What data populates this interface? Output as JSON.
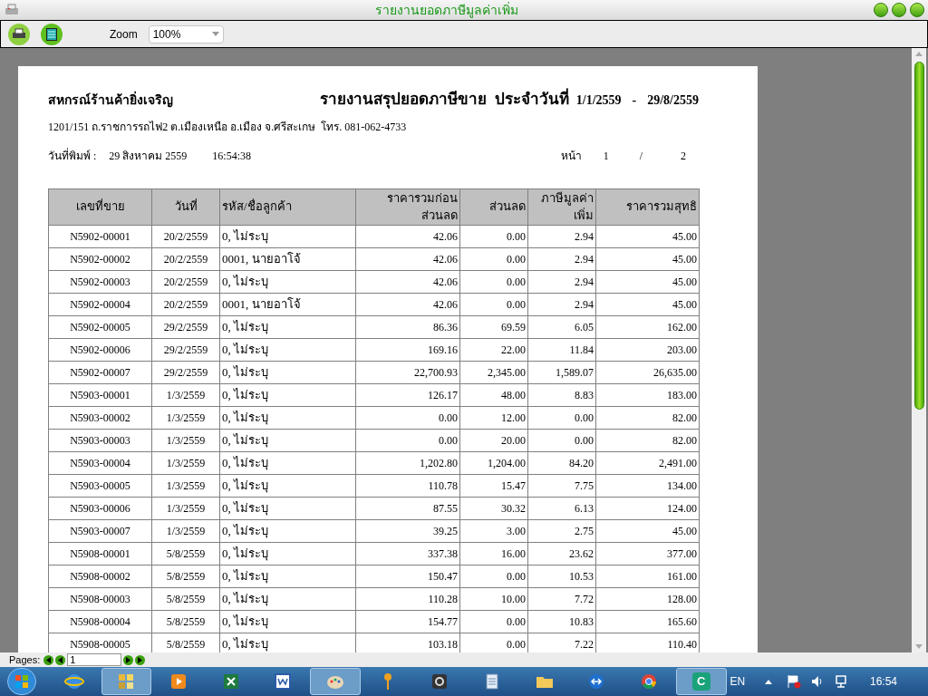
{
  "window": {
    "title": "รายงานยอดภาษีมูลค่าเพิ่ม"
  },
  "toolbar": {
    "zoom_label": "Zoom",
    "zoom_value": "100%"
  },
  "report": {
    "company": "สหกรณ์ร้านค้ายิ่งเจริญ",
    "title": "รายงานสรุปยอดภาษีขาย  ประจำวันที่",
    "date_from": "1/1/2559",
    "date_sep": "-",
    "date_to": "29/8/2559",
    "address": "1201/151 ถ.ราชการรถไฟ2 ต.เมืองเหนือ อ.เมือง จ.ศรีสะเกษ  โทร. 081-062-4733",
    "print_label": "วันที่พิมพ์ :",
    "print_date": "29 สิงหาคม 2559",
    "print_time": "16:54:38",
    "page_label": "หน้า",
    "page_no": "1",
    "page_sep": "/",
    "page_total": "2"
  },
  "table": {
    "columns": [
      "เลขที่ขาย",
      "วันที่",
      "รหัส/ชื่อลูกค้า",
      "ราคารวมก่อนส่วนลด",
      "ส่วนลด",
      "ภาษีมูลค่าเพิ่ม",
      "ราคารวมสุทธิ"
    ],
    "rows": [
      [
        "N5902-00001",
        "20/2/2559",
        "0, ไม่ระบุ",
        "42.06",
        "0.00",
        "2.94",
        "45.00"
      ],
      [
        "N5902-00002",
        "20/2/2559",
        "0001, นายอาโจ้",
        "42.06",
        "0.00",
        "2.94",
        "45.00"
      ],
      [
        "N5902-00003",
        "20/2/2559",
        "0, ไม่ระบุ",
        "42.06",
        "0.00",
        "2.94",
        "45.00"
      ],
      [
        "N5902-00004",
        "20/2/2559",
        "0001, นายอาโจ้",
        "42.06",
        "0.00",
        "2.94",
        "45.00"
      ],
      [
        "N5902-00005",
        "29/2/2559",
        "0, ไม่ระบุ",
        "86.36",
        "69.59",
        "6.05",
        "162.00"
      ],
      [
        "N5902-00006",
        "29/2/2559",
        "0, ไม่ระบุ",
        "169.16",
        "22.00",
        "11.84",
        "203.00"
      ],
      [
        "N5902-00007",
        "29/2/2559",
        "0, ไม่ระบุ",
        "22,700.93",
        "2,345.00",
        "1,589.07",
        "26,635.00"
      ],
      [
        "N5903-00001",
        "1/3/2559",
        "0, ไม่ระบุ",
        "126.17",
        "48.00",
        "8.83",
        "183.00"
      ],
      [
        "N5903-00002",
        "1/3/2559",
        "0, ไม่ระบุ",
        "0.00",
        "12.00",
        "0.00",
        "82.00"
      ],
      [
        "N5903-00003",
        "1/3/2559",
        "0, ไม่ระบุ",
        "0.00",
        "20.00",
        "0.00",
        "82.00"
      ],
      [
        "N5903-00004",
        "1/3/2559",
        "0, ไม่ระบุ",
        "1,202.80",
        "1,204.00",
        "84.20",
        "2,491.00"
      ],
      [
        "N5903-00005",
        "1/3/2559",
        "0, ไม่ระบุ",
        "110.78",
        "15.47",
        "7.75",
        "134.00"
      ],
      [
        "N5903-00006",
        "1/3/2559",
        "0, ไม่ระบุ",
        "87.55",
        "30.32",
        "6.13",
        "124.00"
      ],
      [
        "N5903-00007",
        "1/3/2559",
        "0, ไม่ระบุ",
        "39.25",
        "3.00",
        "2.75",
        "45.00"
      ],
      [
        "N5908-00001",
        "5/8/2559",
        "0, ไม่ระบุ",
        "337.38",
        "16.00",
        "23.62",
        "377.00"
      ],
      [
        "N5908-00002",
        "5/8/2559",
        "0, ไม่ระบุ",
        "150.47",
        "0.00",
        "10.53",
        "161.00"
      ],
      [
        "N5908-00003",
        "5/8/2559",
        "0, ไม่ระบุ",
        "110.28",
        "10.00",
        "7.72",
        "128.00"
      ],
      [
        "N5908-00004",
        "5/8/2559",
        "0, ไม่ระบุ",
        "154.77",
        "0.00",
        "10.83",
        "165.60"
      ],
      [
        "N5908-00005",
        "5/8/2559",
        "0, ไม่ระบุ",
        "103.18",
        "0.00",
        "7.22",
        "110.40"
      ]
    ]
  },
  "pager": {
    "label": "Pages:",
    "value": "1"
  },
  "taskbar": {
    "apps": [
      {
        "kind": "browser",
        "active": false
      },
      {
        "kind": "windows",
        "active": true
      },
      {
        "kind": "player",
        "active": false
      },
      {
        "kind": "sheet",
        "active": false
      },
      {
        "kind": "doc",
        "active": false
      },
      {
        "kind": "paint",
        "active": true
      },
      {
        "kind": "key",
        "active": false
      },
      {
        "kind": "camera",
        "active": false
      },
      {
        "kind": "notepad",
        "active": false
      },
      {
        "kind": "folder",
        "active": false
      },
      {
        "kind": "remote",
        "active": false
      },
      {
        "kind": "chrome",
        "active": false
      },
      {
        "kind": "app",
        "active": true,
        "letter": "C"
      }
    ],
    "language": "EN",
    "clock": "16:54"
  }
}
